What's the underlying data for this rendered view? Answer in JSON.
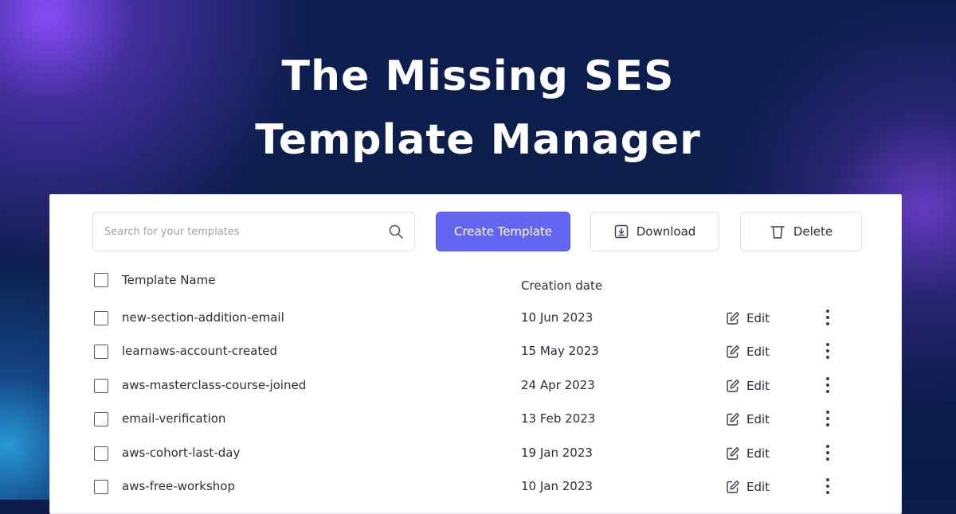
{
  "headline": {
    "line1": "The Missing SES",
    "line2": "Template Manager"
  },
  "colors": {
    "background": "#0c1d4b",
    "accent": "#6366f1",
    "panel": "#ffffff"
  },
  "toolbar": {
    "search_placeholder": "Search for your templates",
    "search_icon": "search-icon",
    "create_label": "Create Template",
    "download_label": "Download",
    "download_icon": "download-icon",
    "delete_label": "Delete",
    "delete_icon": "trash-icon"
  },
  "table": {
    "columns": [
      "Template Name",
      "Creation date"
    ],
    "edit_label": "Edit",
    "rows": [
      {
        "name": "new-section-addition-email",
        "date": "10 Jun 2023"
      },
      {
        "name": "learnaws-account-created",
        "date": "15 May 2023"
      },
      {
        "name": "aws-masterclass-course-joined",
        "date": "24 Apr 2023"
      },
      {
        "name": "email-verification",
        "date": "13 Feb 2023"
      },
      {
        "name": "aws-cohort-last-day",
        "date": "19 Jan 2023"
      },
      {
        "name": "aws-free-workshop",
        "date": "10 Jan 2023"
      }
    ]
  }
}
